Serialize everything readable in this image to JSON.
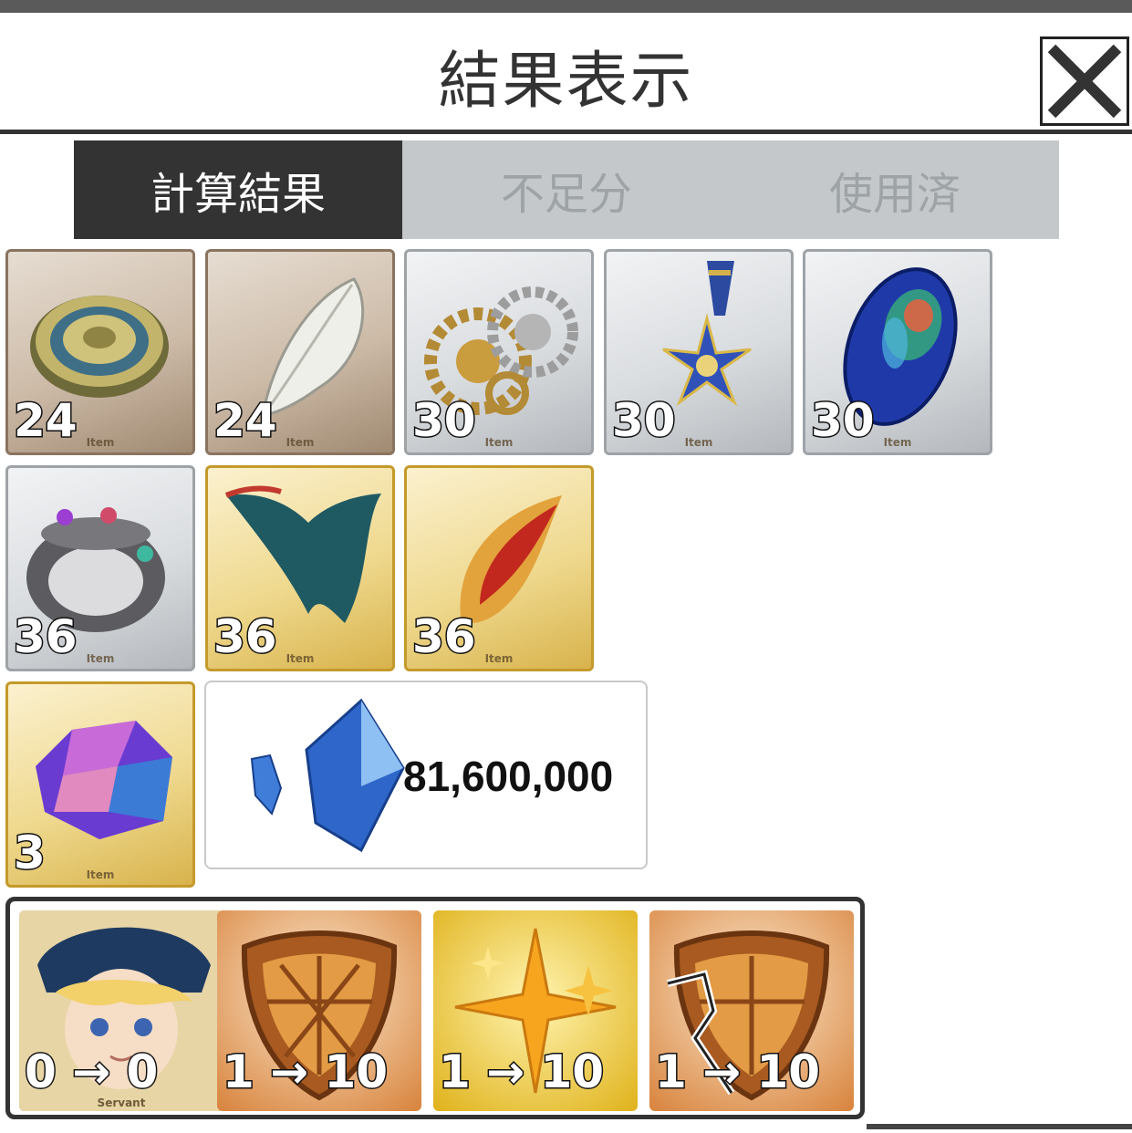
{
  "header": {
    "title": "結果表示"
  },
  "tabs": [
    {
      "label": "計算結果",
      "active": true
    },
    {
      "label": "不足分",
      "active": false
    },
    {
      "label": "使用済",
      "active": false
    }
  ],
  "items": [
    {
      "count": "24",
      "label": "Item",
      "rarity": "bronze",
      "icon": "disc-icon"
    },
    {
      "count": "24",
      "label": "Item",
      "rarity": "bronze",
      "icon": "feather-icon"
    },
    {
      "count": "30",
      "label": "Item",
      "rarity": "silver",
      "icon": "gear-icon"
    },
    {
      "count": "30",
      "label": "Item",
      "rarity": "silver",
      "icon": "medal-icon"
    },
    {
      "count": "30",
      "label": "Item",
      "rarity": "silver",
      "icon": "gem-icon"
    },
    {
      "count": "36",
      "label": "Item",
      "rarity": "silver",
      "icon": "ring-icon"
    },
    {
      "count": "36",
      "label": "Item",
      "rarity": "gold",
      "icon": "wing-icon"
    },
    {
      "count": "36",
      "label": "Item",
      "rarity": "gold",
      "icon": "plume-icon"
    },
    {
      "count": "3",
      "label": "Item",
      "rarity": "gold",
      "icon": "crystal-block-icon"
    }
  ],
  "qp": {
    "value": "81,600,000",
    "icon": "qp-crystal-icon"
  },
  "skills": [
    {
      "text": "0 → 0",
      "label": "Servant",
      "icon": "servant-portrait-icon"
    },
    {
      "text": "1 → 10",
      "icon": "shield-icon"
    },
    {
      "text": "1 → 10",
      "icon": "sparkle-icon"
    },
    {
      "text": "1 → 10",
      "icon": "broken-shield-icon"
    }
  ]
}
